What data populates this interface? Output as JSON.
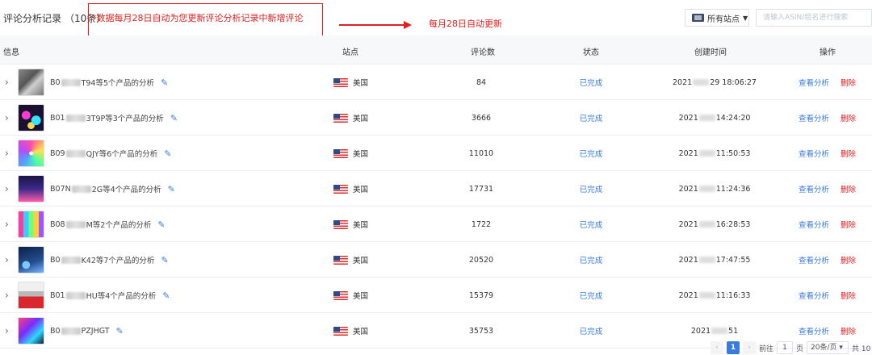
{
  "header": {
    "title": "评论分析记录",
    "count": "（10条）",
    "note": "*数据每月28日自动为您更新评论分析记录中新增评论",
    "arrow_label": "每月28日自动更新",
    "site_select": "所有站点",
    "search_placeholder": "请输入ASIN/组名进行搜索"
  },
  "table": {
    "columns": [
      "信息",
      "站点",
      "评论数",
      "状态",
      "创建时间",
      "操作"
    ],
    "rows": [
      {
        "asin_prefix": "B0",
        "asin_suffix": "T94等5个产品的分析",
        "site": "美国",
        "reviews": "84",
        "status": "已完成",
        "time_prefix": "2021",
        "time_suffix": "29 18:06:27",
        "thumb": "phone-case"
      },
      {
        "asin_prefix": "B01",
        "asin_suffix": "3T9P等3个产品的分析",
        "site": "美国",
        "reviews": "3666",
        "status": "已完成",
        "time_prefix": "2021",
        "time_suffix": "14:24:20",
        "thumb": "rgb-lights"
      },
      {
        "asin_prefix": "B09",
        "asin_suffix": "QJY等6个产品的分析",
        "site": "美国",
        "reviews": "11010",
        "status": "已完成",
        "time_prefix": "2021",
        "time_suffix": "11:50:53",
        "thumb": "led-strip"
      },
      {
        "asin_prefix": "B07N",
        "asin_suffix": "2G等4个产品的分析",
        "site": "美国",
        "reviews": "17731",
        "status": "已完成",
        "time_prefix": "2021",
        "time_suffix": "11:24:36",
        "thumb": "led-room"
      },
      {
        "asin_prefix": "B08",
        "asin_suffix": "M等2个产品的分析",
        "site": "美国",
        "reviews": "1722",
        "status": "已完成",
        "time_prefix": "2021",
        "time_suffix": "16:28:53",
        "thumb": "light-bars"
      },
      {
        "asin_prefix": "B0",
        "asin_suffix": "K42等7个产品的分析",
        "site": "美国",
        "reviews": "20520",
        "status": "已完成",
        "time_prefix": "2021",
        "time_suffix": "17:47:55",
        "thumb": "projector"
      },
      {
        "asin_prefix": "B01",
        "asin_suffix": "HU等4个产品的分析",
        "site": "美国",
        "reviews": "15379",
        "status": "已完成",
        "time_prefix": "2021",
        "time_suffix": "11:16:33",
        "thumb": "sd-card"
      },
      {
        "asin_prefix": "B0",
        "asin_suffix": "PZJHGT",
        "site": "美国",
        "reviews": "35753",
        "status": "已完成",
        "time_prefix": "2021",
        "time_suffix": "51",
        "thumb": "strip-lights"
      }
    ],
    "view_label": "查看分析",
    "delete_label": "删除"
  },
  "pagination": {
    "current": "1",
    "goto_label": "前往",
    "page_input": "1",
    "page_unit": "页",
    "page_size": "20条/页",
    "total": "共 10"
  },
  "colors": {
    "accent": "#3a7be0",
    "danger": "#e02020"
  }
}
